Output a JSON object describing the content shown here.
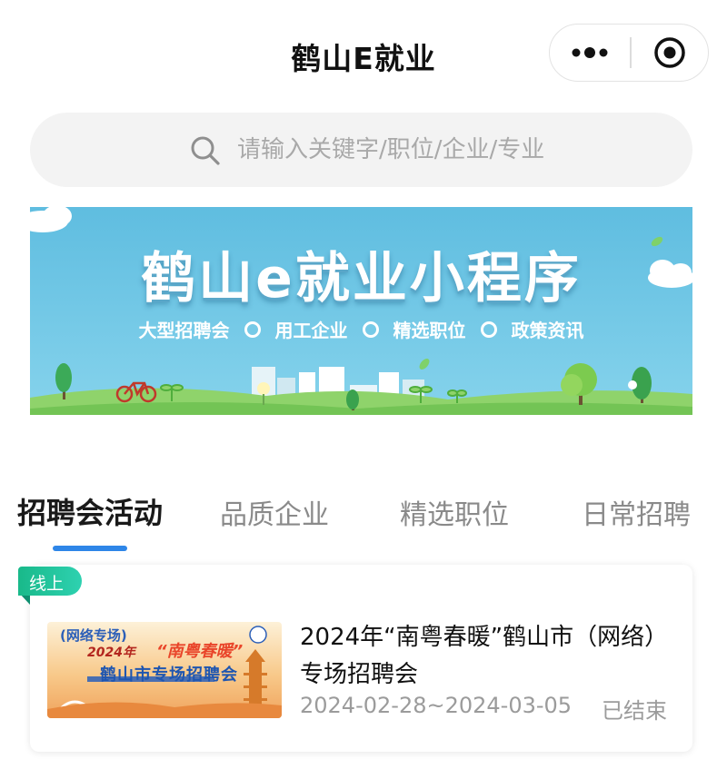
{
  "app": {
    "title": "鹤山E就业"
  },
  "search": {
    "placeholder": "请输入关键字/职位/企业/专业"
  },
  "banner": {
    "title": "鹤山e就业小程序",
    "tags": [
      "大型招聘会",
      "用工企业",
      "精选职位",
      "政策资讯"
    ]
  },
  "tabs": [
    {
      "label": "招聘会活动",
      "active": true
    },
    {
      "label": "品质企业",
      "active": false
    },
    {
      "label": "精选职位",
      "active": false
    },
    {
      "label": "日常招聘",
      "active": false
    }
  ],
  "events": [
    {
      "badge": "线上",
      "poster": {
        "line1": "(网络专场)",
        "line2": "2024年",
        "line3": "“南粤春暖”",
        "line4": "鹤山市专场招聘会"
      },
      "title": "2024年“南粤春暖”鹤山市（网络）专场招聘会",
      "date_range": "2024-02-28~2024-03-05",
      "status": "已结束"
    }
  ],
  "colors": {
    "accent": "#2e86e8",
    "badge": "#19b98a",
    "banner_sky": "#6cc3e3",
    "banner_grass": "#8fd36b"
  },
  "icons": {
    "more": "more-dots-icon",
    "close": "target-close-icon",
    "search": "search-icon"
  }
}
